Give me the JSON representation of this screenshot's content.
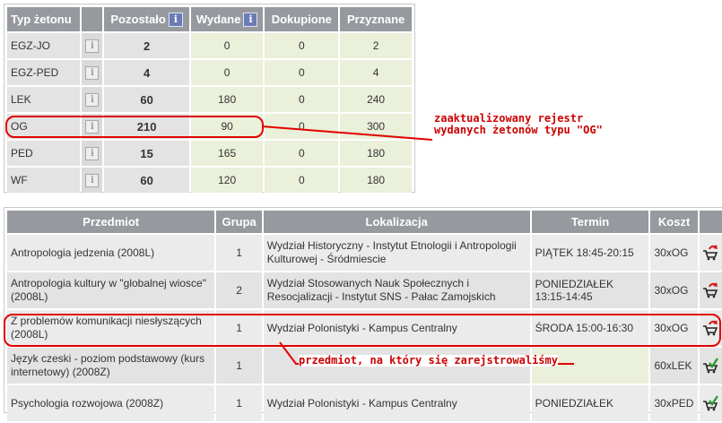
{
  "tokens": {
    "headers": {
      "type": "Typ żetonu",
      "remaining": "Pozostało",
      "issued": "Wydane",
      "bought": "Dokupione",
      "granted": "Przyznane",
      "info_glyph": "i"
    },
    "rows": [
      {
        "type": "EGZ-JO",
        "remaining": "2",
        "issued": "0",
        "bought": "0",
        "granted": "2"
      },
      {
        "type": "EGZ-PED",
        "remaining": "4",
        "issued": "0",
        "bought": "0",
        "granted": "4"
      },
      {
        "type": "LEK",
        "remaining": "60",
        "issued": "180",
        "bought": "0",
        "granted": "240"
      },
      {
        "type": "OG",
        "remaining": "210",
        "issued": "90",
        "bought": "0",
        "granted": "300"
      },
      {
        "type": "PED",
        "remaining": "15",
        "issued": "165",
        "bought": "0",
        "granted": "180"
      },
      {
        "type": "WF",
        "remaining": "60",
        "issued": "120",
        "bought": "0",
        "granted": "180"
      }
    ]
  },
  "courses": {
    "headers": {
      "subject": "Przedmiot",
      "group": "Grupa",
      "location": "Lokalizacja",
      "term": "Termin",
      "cost": "Koszt"
    },
    "rows": [
      {
        "subject": "Antropologia jedzenia (2008L)",
        "group": "1",
        "location": "Wydział Historyczny - Instytut Etnologii i Antropologii Kulturowej - Śródmiescie",
        "term": "PIĄTEK 18:45-20:15",
        "cost": "30xOG",
        "action": "cart-remove-icon"
      },
      {
        "subject": "Antropologia kultury w \"globalnej wiosce\" (2008L)",
        "group": "2",
        "location": "Wydział Stosowanych Nauk Społecznych i Resocjalizacji - Instytut SNS - Pałac Zamojskich",
        "term": "PONIEDZIAŁEK 13:15-14:45",
        "cost": "30xOG",
        "action": "cart-remove-icon"
      },
      {
        "subject": "Z problemów komunikacji niesłyszących (2008L)",
        "group": "1",
        "location": "Wydział Polonistyki - Kampus Centralny",
        "term": "ŚRODA 15:00-16:30",
        "cost": "30xOG",
        "action": "cart-remove-icon"
      },
      {
        "subject": "Język czeski - poziom podstawowy (kurs internetowy) (2008Z)",
        "group": "1",
        "location": "",
        "term": "",
        "cost": "60xLEK",
        "action": "cart-check-icon"
      },
      {
        "subject": "Psychologia rozwojowa (2008Z)",
        "group": "1",
        "location": "Wydział Polonistyki - Kampus Centralny",
        "term": "PONIEDZIAŁEK",
        "cost": "30xPED",
        "action": "cart-check-icon"
      }
    ]
  },
  "annotations": {
    "register_note_line1": "zaaktualizowany rejestr",
    "register_note_line2": "wydanych żetonów typu \"OG\"",
    "course_note": "przedmiot, na który się zarejstrowaliśmy",
    "color": "#e10000"
  }
}
